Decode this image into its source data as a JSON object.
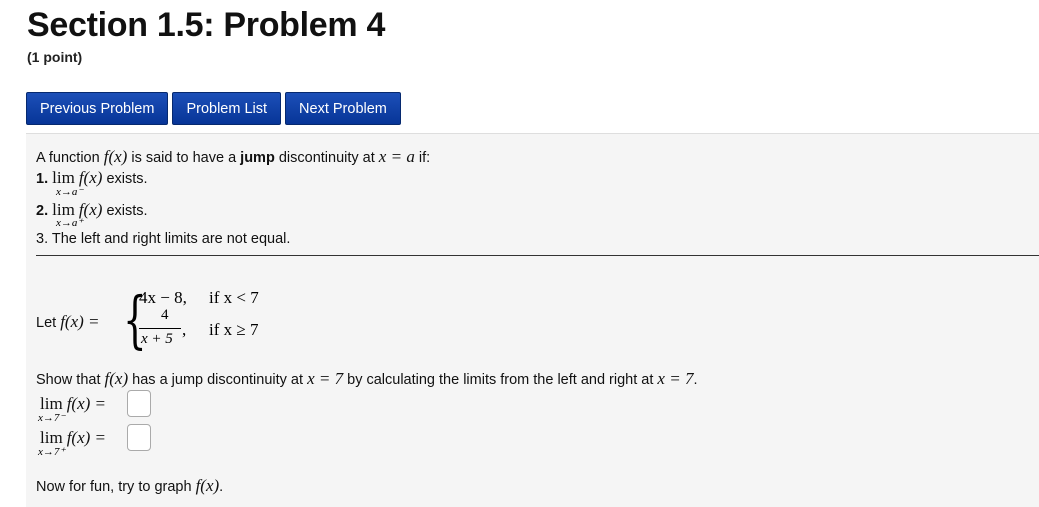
{
  "header": {
    "title": "Section 1.5: Problem 4",
    "points": "(1 point)"
  },
  "nav": {
    "previous": "Previous Problem",
    "list": "Problem List",
    "next": "Next Problem"
  },
  "definition": {
    "intro_prefix": "A function",
    "fx": "f(x)",
    "intro_mid": "is said to have a",
    "jump_word": "jump",
    "intro_mid2": "discontinuity at",
    "eq": "x = a",
    "intro_suffix": "if:",
    "item1_num": "1.",
    "item1_lim": "lim",
    "item1_sub": "x→a⁻",
    "item1_fx": "f(x)",
    "item1_text": "exists.",
    "item2_num": "2.",
    "item2_lim": "lim",
    "item2_sub": "x→a⁺",
    "item2_fx": "f(x)",
    "item2_text": "exists.",
    "item3": "3. The left and right limits are not equal."
  },
  "piecewise": {
    "let_prefix": "Let",
    "let_fx": "f(x) =",
    "case1_expr": "4x − 8,",
    "case1_cond": "if x < 7",
    "case2_num": "4",
    "case2_den": "x + 5",
    "case2_comma": ",",
    "case2_cond": "if x ≥ 7"
  },
  "question": {
    "prefix": "Show that",
    "fx": "f(x)",
    "mid": "has a jump discontinuity at",
    "eq1": "x = 7",
    "mid2": "by calculating the limits from the left and right at",
    "eq2": "x = 7",
    "end": "."
  },
  "answers": {
    "left_lim": "lim",
    "left_sub": "x→7⁻",
    "left_fx": "f(x) =",
    "left_value": "",
    "right_lim": "lim",
    "right_sub": "x→7⁺",
    "right_fx": "f(x) =",
    "right_value": ""
  },
  "footer": {
    "text": "Now for fun, try to graph",
    "fx": "f(x)",
    "end": "."
  }
}
